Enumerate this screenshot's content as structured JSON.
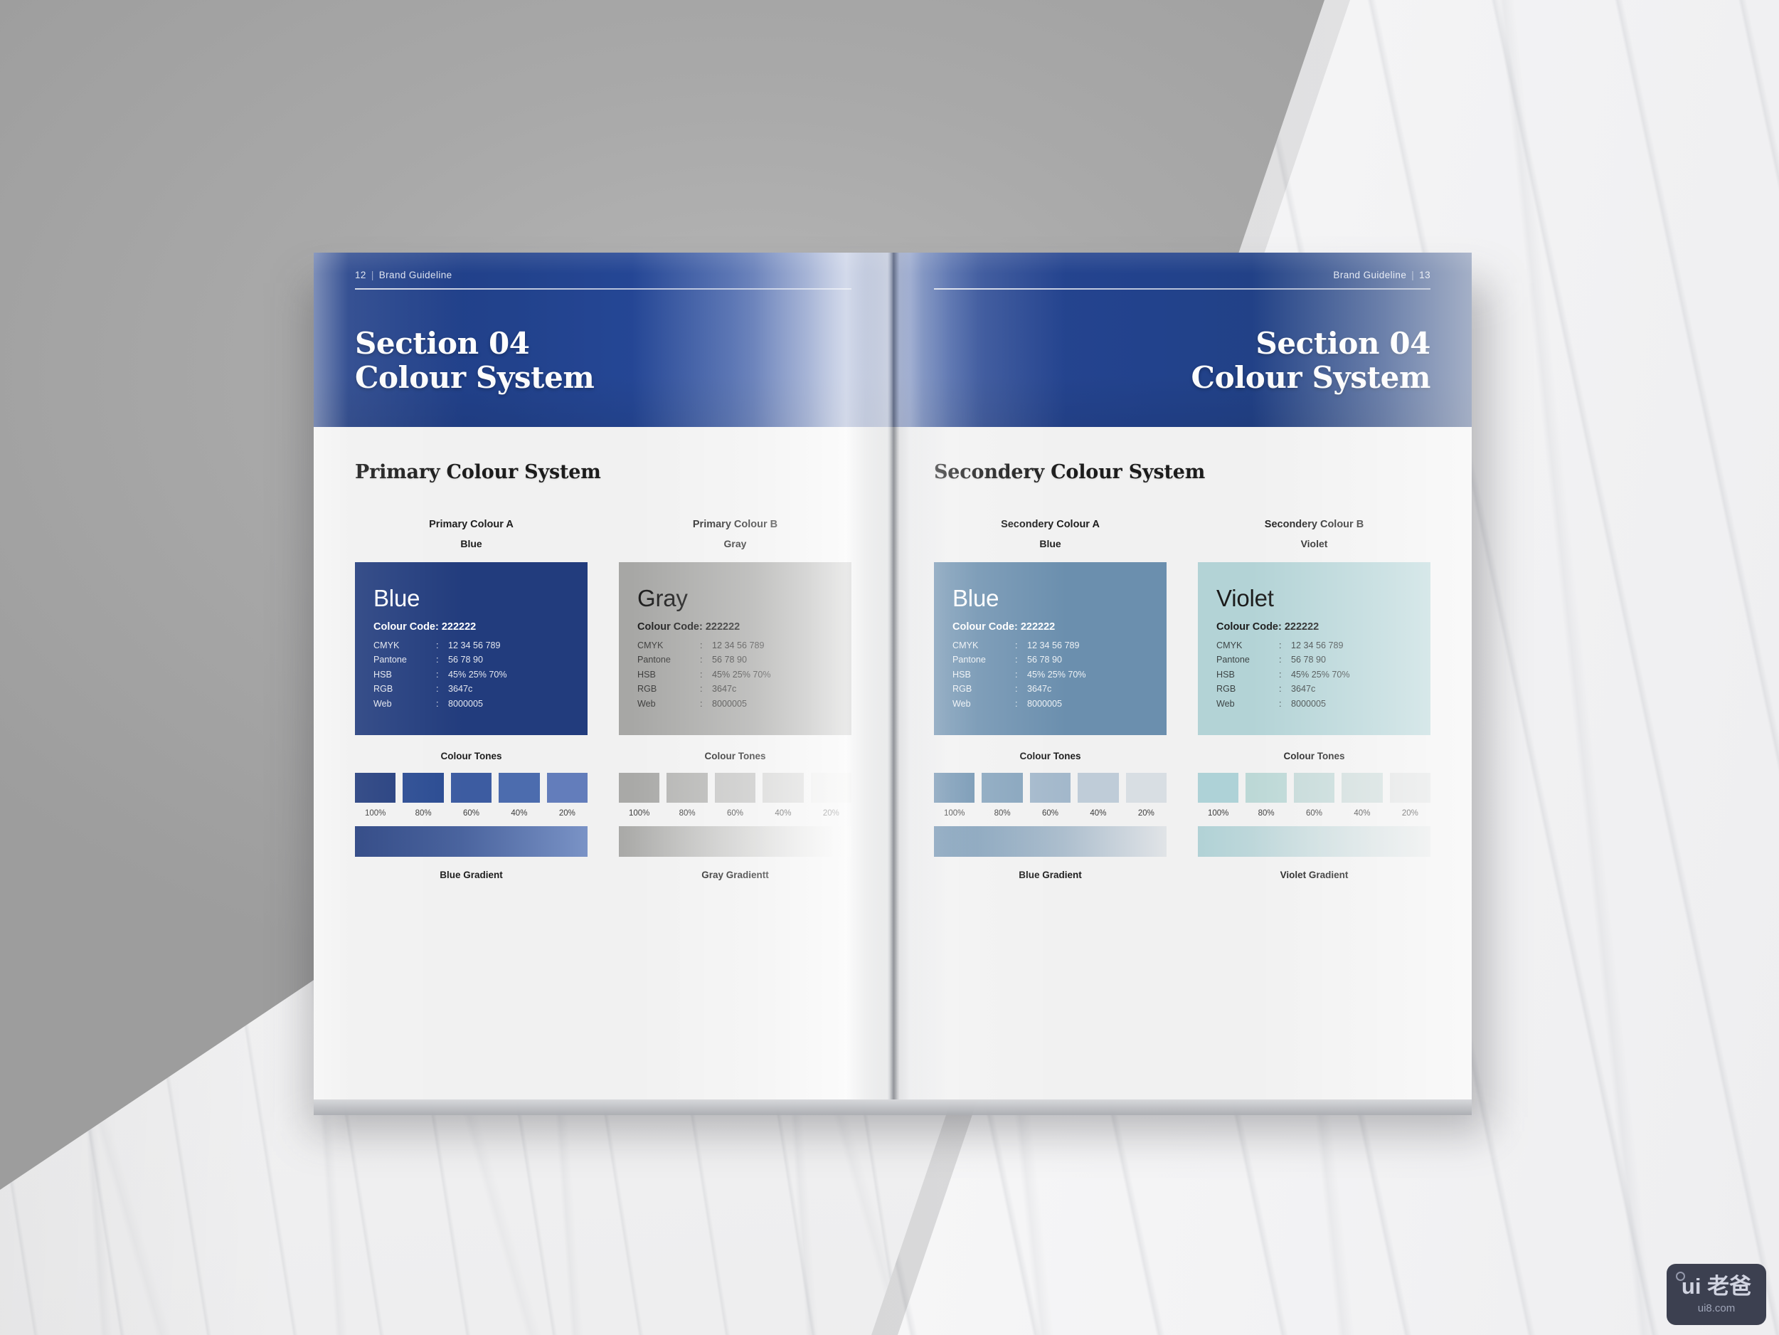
{
  "document": {
    "type": "brand-guideline-spread-mockup",
    "watermark": {
      "brand": "ui 老爸",
      "url": "ui8.com"
    }
  },
  "pages": {
    "left": {
      "folio_number": "12",
      "folio_separator": "|",
      "folio_label": "Brand Guideline",
      "section_title": "Section 04\nColour System",
      "system_title": "Primary Colour System",
      "columns": [
        {
          "caption_a": "Primary Colour A",
          "caption_b": "Blue",
          "swatch": {
            "name": "Blue",
            "bg": "#223c7d",
            "text_mode": "light",
            "colour_code_label": "Colour Code: 222222",
            "specs": [
              {
                "key": "CMYK",
                "sep": ":",
                "value": "12 34 56 789"
              },
              {
                "key": "Pantone",
                "sep": ":",
                "value": "56 78 90"
              },
              {
                "key": "HSB",
                "sep": ":",
                "value": "45% 25% 70%"
              },
              {
                "key": "RGB",
                "sep": ":",
                "value": "3647c"
              },
              {
                "key": "Web",
                "sep": ":",
                "value": "8000005"
              }
            ]
          },
          "tones_label": "Colour Tones",
          "tones": [
            {
              "pct": "100%",
              "hex": "#223c7d"
            },
            {
              "pct": "80%",
              "hex": "#2a4b92"
            },
            {
              "pct": "60%",
              "hex": "#3d5ca1"
            },
            {
              "pct": "40%",
              "hex": "#4c6cae"
            },
            {
              "pct": "20%",
              "hex": "#637dbb"
            }
          ],
          "gradient_from": "#223c7d",
          "gradient_to": "#7a93c6",
          "gradient_label": "Blue Gradient"
        },
        {
          "caption_a": "Primary Colour B",
          "caption_b": "Gray",
          "swatch": {
            "name": "Gray",
            "bg": "#a7a7a5",
            "text_mode": "dark",
            "colour_code_label": "Colour Code: 222222",
            "specs": [
              {
                "key": "CMYK",
                "sep": ":",
                "value": "12 34 56 789"
              },
              {
                "key": "Pantone",
                "sep": ":",
                "value": "56 78 90"
              },
              {
                "key": "HSB",
                "sep": ":",
                "value": "45% 25% 70%"
              },
              {
                "key": "RGB",
                "sep": ":",
                "value": "3647c"
              },
              {
                "key": "Web",
                "sep": ":",
                "value": "8000005"
              }
            ]
          },
          "tones_label": "Colour Tones",
          "tones": [
            {
              "pct": "100%",
              "hex": "#a9a9a7"
            },
            {
              "pct": "80%",
              "hex": "#b4b4b2"
            },
            {
              "pct": "60%",
              "hex": "#c3c3c2"
            },
            {
              "pct": "40%",
              "hex": "#d2d2d1"
            },
            {
              "pct": "20%",
              "hex": "#e9e9e8"
            }
          ],
          "gradient_from": "#a9a9a7",
          "gradient_to": "#f4f4f3",
          "gradient_label": "Gray Gradientt"
        }
      ]
    },
    "right": {
      "folio_label": "Brand Guideline",
      "folio_separator": "|",
      "folio_number": "13",
      "section_title": "Section 04\nColour System",
      "system_title": "Secondery Colour System",
      "columns": [
        {
          "caption_a": "Secondery Colour A",
          "caption_b": "Blue",
          "swatch": {
            "name": "Blue",
            "bg": "#6b8fae",
            "text_mode": "light",
            "colour_code_label": "Colour Code: 222222",
            "specs": [
              {
                "key": "CMYK",
                "sep": ":",
                "value": "12 34 56 789"
              },
              {
                "key": "Pantone",
                "sep": ":",
                "value": "56 78 90"
              },
              {
                "key": "HSB",
                "sep": ":",
                "value": "45% 25% 70%"
              },
              {
                "key": "RGB",
                "sep": ":",
                "value": "3647c"
              },
              {
                "key": "Web",
                "sep": ":",
                "value": "8000005"
              }
            ]
          },
          "tones_label": "Colour Tones",
          "tones": [
            {
              "pct": "100%",
              "hex": "#6b8fae"
            },
            {
              "pct": "80%",
              "hex": "#85a3bc"
            },
            {
              "pct": "60%",
              "hex": "#a3b8cb"
            },
            {
              "pct": "40%",
              "hex": "#bfccd8"
            },
            {
              "pct": "20%",
              "hex": "#d8dee3"
            }
          ],
          "gradient_from": "#6b8fae",
          "gradient_to": "#e1e4e7",
          "gradient_label": "Blue Gradient"
        },
        {
          "caption_a": "Secondery Colour B",
          "caption_b": "Violet",
          "swatch": {
            "name": "Violet",
            "bg": "#b3d3d6",
            "text_mode": "dark",
            "colour_code_label": "Colour Code: 222222",
            "specs": [
              {
                "key": "CMYK",
                "sep": ":",
                "value": "12 34 56 789"
              },
              {
                "key": "Pantone",
                "sep": ":",
                "value": "56 78 90"
              },
              {
                "key": "HSB",
                "sep": ":",
                "value": "45% 25% 70%"
              },
              {
                "key": "RGB",
                "sep": ":",
                "value": "3647c"
              },
              {
                "key": "Web",
                "sep": ":",
                "value": "8000005"
              }
            ]
          },
          "tones_label": "Colour Tones",
          "tones": [
            {
              "pct": "100%",
              "hex": "#aed2d7"
            },
            {
              "pct": "80%",
              "hex": "#bcd8d6"
            },
            {
              "pct": "60%",
              "hex": "#c4d9d8"
            },
            {
              "pct": "40%",
              "hex": "#cfdcdb"
            },
            {
              "pct": "20%",
              "hex": "#e0e2e2"
            }
          ],
          "gradient_from": "#b1d2d6",
          "gradient_to": "#e6e8e8",
          "gradient_label": "Violet Gradient"
        }
      ]
    }
  }
}
